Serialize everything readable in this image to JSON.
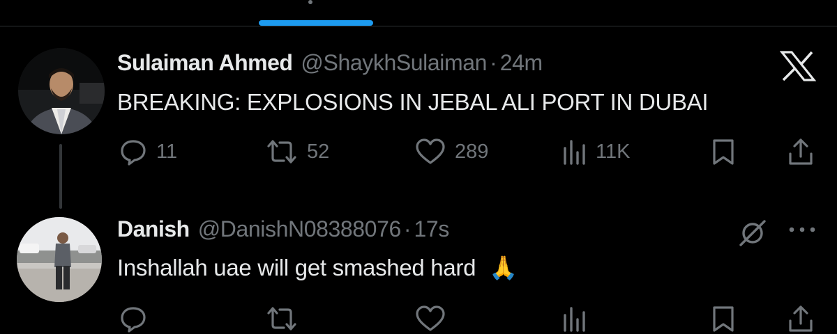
{
  "colors": {
    "accent": "#1d9bf0",
    "muted": "#71767b",
    "text": "#e7e9ea",
    "background": "#000000",
    "emoji": "#f5c04a"
  },
  "tweet1": {
    "name": "Sulaiman Ahmed",
    "handle": "@ShaykhSulaiman",
    "separator": "·",
    "time": "24m",
    "text": "BREAKING: EXPLOSIONS IN JEBAL ALI PORT IN DUBAI",
    "source_icon": "x-logo-icon",
    "actions": {
      "replies": "11",
      "retweets": "52",
      "likes": "289",
      "views": "11K"
    }
  },
  "tweet2": {
    "name": "Danish",
    "handle": "@DanishN08388076",
    "separator": "·",
    "time": "17s",
    "text": "Inshallah uae will get smashed hard",
    "emoji": "🙏",
    "icons": [
      "mute-icon",
      "more-icon"
    ],
    "actions": {
      "replies": "",
      "retweets": "",
      "likes": "",
      "views": ""
    }
  }
}
